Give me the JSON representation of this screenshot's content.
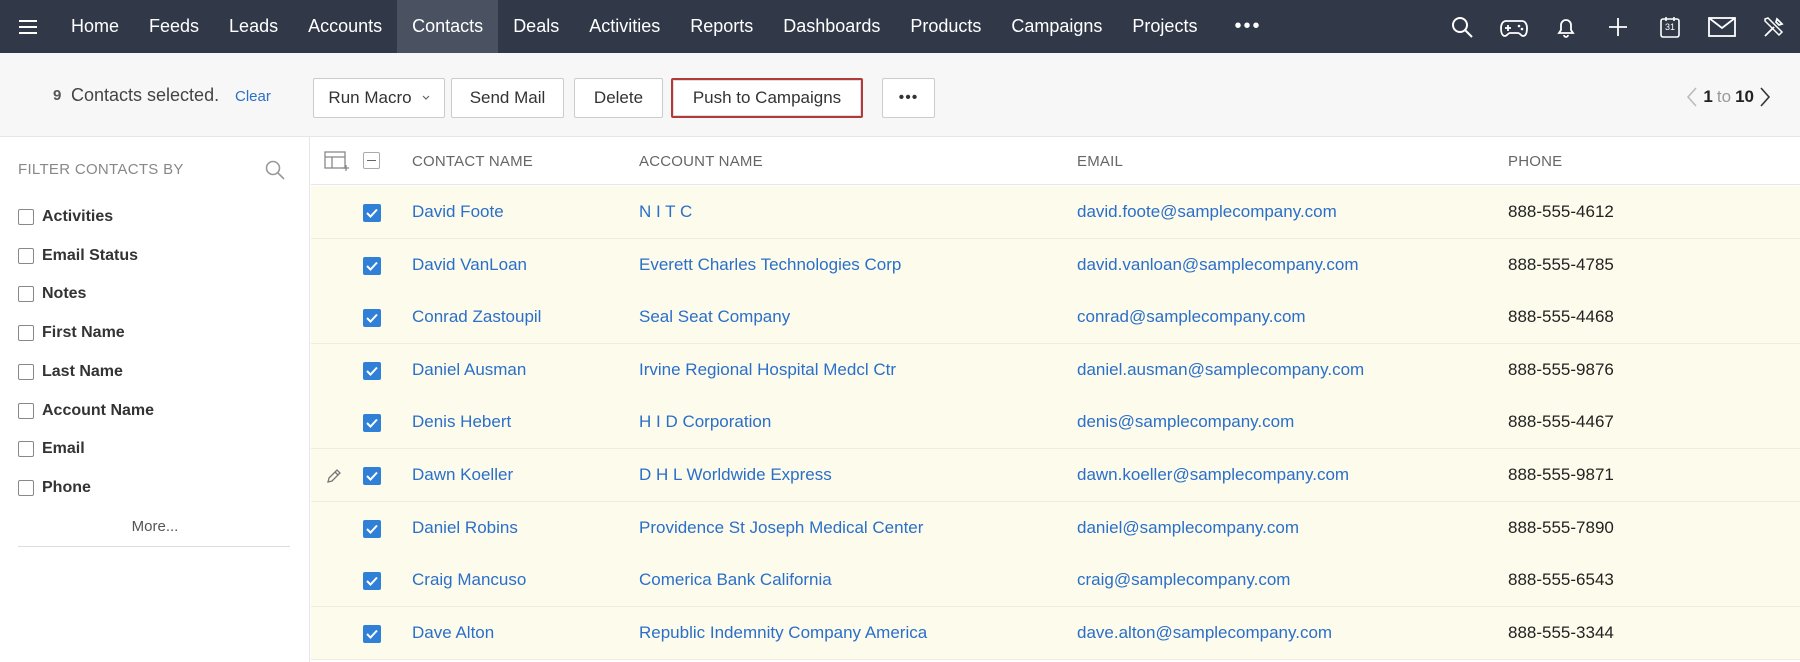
{
  "nav": {
    "items": [
      "Home",
      "Feeds",
      "Leads",
      "Accounts",
      "Contacts",
      "Deals",
      "Activities",
      "Reports",
      "Dashboards",
      "Products",
      "Campaigns",
      "Projects"
    ],
    "active": "Contacts",
    "more": "•••",
    "icons": [
      "search-icon",
      "game-controller-icon",
      "bell-icon",
      "plus-icon",
      "calendar-icon",
      "mail-icon",
      "tools-icon"
    ],
    "calendar_day": "31"
  },
  "actionbar": {
    "selected_count": "9",
    "selected_text": "Contacts selected.",
    "clear_label": "Clear",
    "run_macro_label": "Run Macro",
    "send_mail_label": "Send Mail",
    "delete_label": "Delete",
    "push_label": "Push to Campaigns",
    "more_label": "•••",
    "pager": {
      "from": "1",
      "to_word": "to",
      "to": "10"
    }
  },
  "sidebar": {
    "title": "FILTER CONTACTS BY",
    "filters": [
      "Activities",
      "Email Status",
      "Notes",
      "First Name",
      "Last Name",
      "Account Name",
      "Email",
      "Phone"
    ],
    "more_label": "More..."
  },
  "table": {
    "columns": [
      "CONTACT NAME",
      "ACCOUNT NAME",
      "EMAIL",
      "PHONE"
    ],
    "rows": [
      {
        "name": "David Foote",
        "account": "N I T C",
        "email": "david.foote@samplecompany.com",
        "phone": "888-555-4612"
      },
      {
        "name": "David VanLoan",
        "account": "Everett Charles Technologies Corp",
        "email": "david.vanloan@samplecompany.com",
        "phone": "888-555-4785"
      },
      {
        "name": "Conrad Zastoupil",
        "account": "Seal Seat Company",
        "email": "conrad@samplecompany.com",
        "phone": "888-555-4468"
      },
      {
        "name": "Daniel Ausman",
        "account": "Irvine Regional Hospital Medcl Ctr",
        "email": "daniel.ausman@samplecompany.com",
        "phone": "888-555-9876"
      },
      {
        "name": "Denis Hebert",
        "account": "H I D Corporation",
        "email": "denis@samplecompany.com",
        "phone": "888-555-4467"
      },
      {
        "name": "Dawn Koeller",
        "account": "D H L Worldwide Express",
        "email": "dawn.koeller@samplecompany.com",
        "phone": "888-555-9871"
      },
      {
        "name": "Daniel Robins",
        "account": "Providence St Joseph Medical Center",
        "email": "daniel@samplecompany.com",
        "phone": "888-555-7890"
      },
      {
        "name": "Craig Mancuso",
        "account": "Comerica Bank California",
        "email": "craig@samplecompany.com",
        "phone": "888-555-6543"
      },
      {
        "name": "Dave Alton",
        "account": "Republic Indemnity Company America",
        "email": "dave.alton@samplecompany.com",
        "phone": "888-555-3344"
      }
    ]
  },
  "colors": {
    "nav_bg": "#313949",
    "nav_active": "#4a5262",
    "link": "#2a6fc9",
    "checkbox": "#2f80d6",
    "row_bg": "#fdfbec",
    "highlight_border": "#b33a3a"
  }
}
